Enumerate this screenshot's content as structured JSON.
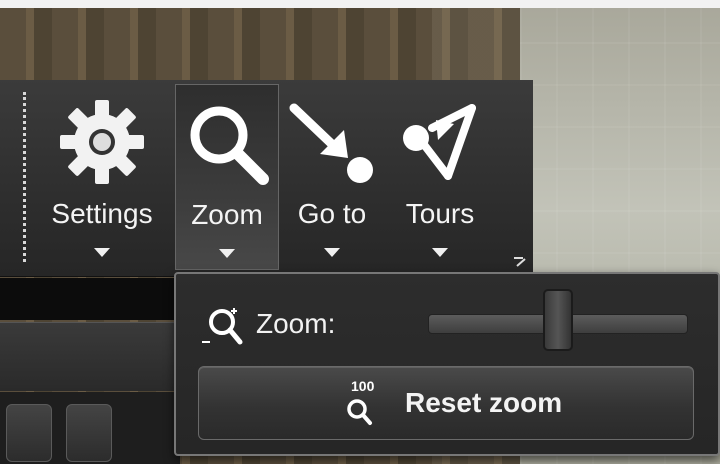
{
  "toolbar": {
    "items": [
      {
        "label": "Settings",
        "icon": "gear-icon"
      },
      {
        "label": "Zoom",
        "icon": "magnifier-icon",
        "active": true
      },
      {
        "label": "Go to",
        "icon": "goto-arrow-icon"
      },
      {
        "label": "Tours",
        "icon": "tours-icon"
      }
    ]
  },
  "zoom_panel": {
    "zoom_label": "Zoom:",
    "zoom_level": 0.5,
    "reset_label": "Reset zoom",
    "reset_icon_badge": "100"
  },
  "colors": {
    "ribbon_bg": "#2f2f2f",
    "text": "#f4f4f4",
    "popup_border": "#777777"
  }
}
